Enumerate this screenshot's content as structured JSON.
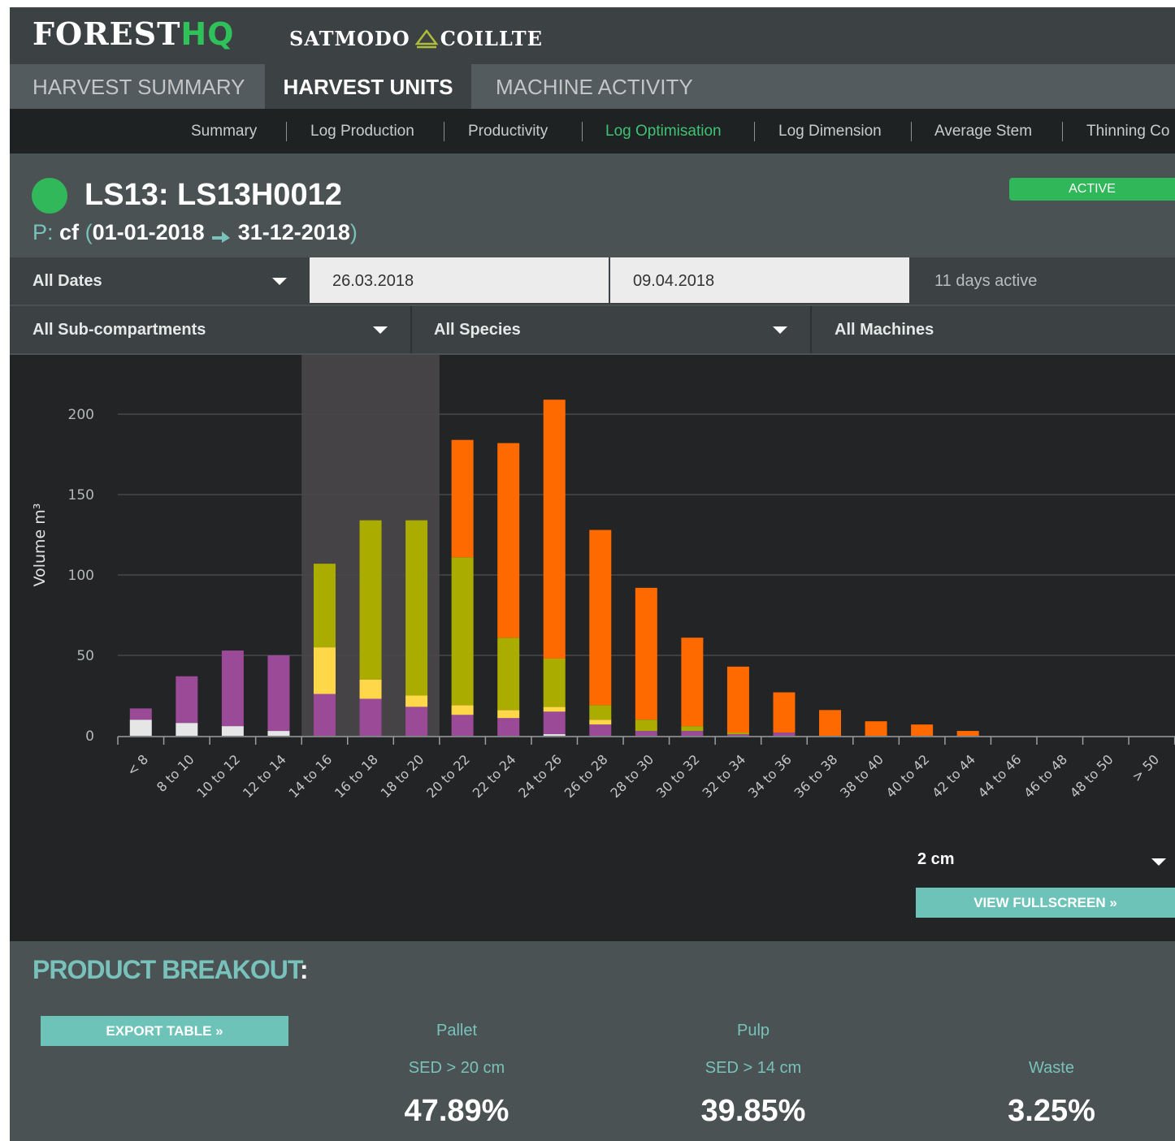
{
  "brand": {
    "forest": "FOREST",
    "hq": "HQ",
    "partner_left": "SATMODO",
    "partner_right": "COILLTE",
    "accent": "#2fc25a"
  },
  "main_tabs": [
    "HARVEST SUMMARY",
    "HARVEST UNITS",
    "MACHINE ACTIVITY"
  ],
  "sub_nav": [
    "Summary",
    "Log Production",
    "Productivity",
    "Log Optimisation",
    "Log Dimension",
    "Average Stem",
    "Thinning Co"
  ],
  "unit": {
    "title": "LS13: LS13H0012",
    "period_label": "P:",
    "species": "cf",
    "open": "(",
    "start": "01-01-2018",
    "end": "31-12-2018",
    "close": ")",
    "status": "ACTIVE",
    "status_color": "#2fb75a"
  },
  "filters": {
    "dates": "All Dates",
    "from": "26.03.2018",
    "to": "09.04.2018",
    "active_days": "11 days active",
    "subcompartments": "All Sub-compartments",
    "species": "All Species",
    "machines": "All Machines"
  },
  "chart_controls": {
    "bin": "2 cm",
    "fullscreen": "VIEW FULLSCREEN »"
  },
  "chart_data": {
    "type": "bar",
    "stacked": true,
    "ylabel": "Volume m³",
    "xlabel": "",
    "ylim": [
      0,
      235
    ],
    "yticks": [
      0,
      50,
      100,
      150,
      200
    ],
    "grid": true,
    "highlight_categories": [
      "14 to 16",
      "16 to 18",
      "18 to 20"
    ],
    "categories": [
      "< 8",
      "8 to 10",
      "10 to 12",
      "12 to 14",
      "14 to 16",
      "16 to 18",
      "18 to 20",
      "20 to 22",
      "22 to 24",
      "24 to 26",
      "26 to 28",
      "28 to 30",
      "30 to 32",
      "32 to 34",
      "34 to 36",
      "36 to 38",
      "38 to 40",
      "40 to 42",
      "42 to 44",
      "44 to 46",
      "46 to 48",
      "48 to 50",
      "> 50"
    ],
    "series": [
      {
        "color": "#e6e6e6",
        "values": [
          10,
          8,
          6,
          3,
          0,
          0,
          0,
          0,
          0,
          1,
          0,
          0,
          0,
          0,
          0,
          0,
          0,
          0,
          0,
          0,
          0,
          0,
          0
        ]
      },
      {
        "color": "#9b4a97",
        "values": [
          7,
          29,
          47,
          47,
          26,
          23,
          18,
          13,
          11,
          14,
          7,
          3,
          3,
          1,
          2,
          0,
          0,
          0,
          0,
          0,
          0,
          0,
          0
        ]
      },
      {
        "color": "#ffd84a",
        "values": [
          0,
          0,
          0,
          0,
          29,
          12,
          7,
          6,
          5,
          3,
          3,
          0,
          0,
          0,
          0,
          0,
          0,
          0,
          0,
          0,
          0,
          0,
          0
        ]
      },
      {
        "color": "#aaad00",
        "values": [
          0,
          0,
          0,
          0,
          52,
          99,
          109,
          92,
          45,
          30,
          9,
          7,
          3,
          1,
          0,
          0,
          0,
          0,
          0,
          0,
          0,
          0,
          0
        ]
      },
      {
        "color": "#ff6a00",
        "values": [
          0,
          0,
          0,
          0,
          0,
          0,
          0,
          73,
          121,
          161,
          109,
          82,
          55,
          41,
          25,
          16,
          9,
          7,
          3,
          0,
          0,
          0,
          0
        ]
      }
    ]
  },
  "breakout": {
    "title": "PRODUCT BREAKOUT",
    "colon": ":",
    "export": "EXPORT TABLE »",
    "products": [
      {
        "name": "Pallet",
        "spec": "SED > 20 cm",
        "pct": "47.89%"
      },
      {
        "name": "Pulp",
        "spec": "SED > 14 cm",
        "pct": "39.85%"
      },
      {
        "name": "",
        "spec": "Waste",
        "pct": "3.25%"
      }
    ]
  }
}
